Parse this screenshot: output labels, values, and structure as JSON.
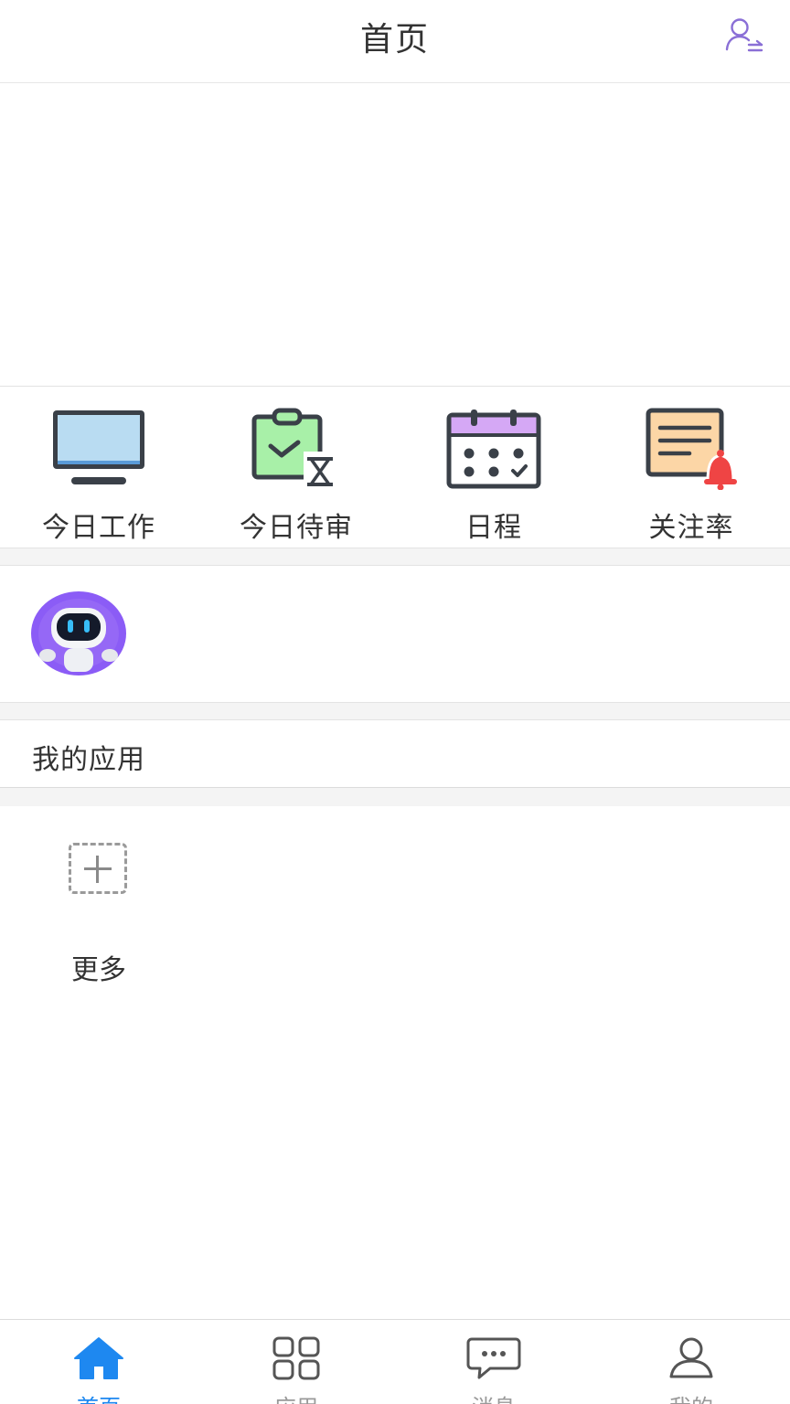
{
  "header": {
    "title": "首页",
    "switch_user_icon": "user-switch-icon"
  },
  "quick_links": [
    {
      "label": "今日工作",
      "icon": "monitor-icon"
    },
    {
      "label": "今日待审",
      "icon": "clipboard-pending-icon"
    },
    {
      "label": "日程",
      "icon": "calendar-icon"
    },
    {
      "label": "关注率",
      "icon": "note-bell-icon"
    }
  ],
  "assistant": {
    "icon": "robot-avatar-icon"
  },
  "my_apps": {
    "title": "我的应用",
    "more_label": "更多"
  },
  "tabbar": {
    "active": 0,
    "items": [
      {
        "label": "首页",
        "icon": "home-icon"
      },
      {
        "label": "应用",
        "icon": "apps-grid-icon"
      },
      {
        "label": "消息",
        "icon": "message-icon"
      },
      {
        "label": "我的",
        "icon": "profile-icon"
      }
    ]
  },
  "colors": {
    "accent": "#1e88f0",
    "header_icon": "#8a6fd6",
    "robot_bg": "#8b5cf6"
  }
}
